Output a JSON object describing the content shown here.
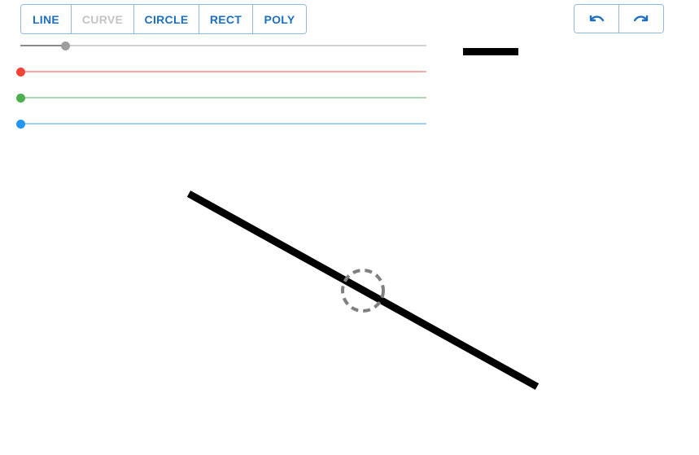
{
  "toolbar": {
    "tools": [
      {
        "label": "LINE",
        "enabled": true
      },
      {
        "label": "CURVE",
        "enabled": false
      },
      {
        "label": "CIRCLE",
        "enabled": true
      },
      {
        "label": "RECT",
        "enabled": true
      },
      {
        "label": "POLY",
        "enabled": true
      }
    ]
  },
  "history": {
    "undo_icon": "undo-icon",
    "redo_icon": "redo-icon"
  },
  "brush": {
    "width_fraction": 0.11,
    "color_rgb": [
      0,
      0,
      0
    ]
  },
  "colors": {
    "accent": "#1e6fbf",
    "disabled": "#c4c4c4",
    "stroke": "#000000",
    "handle": "#808080"
  }
}
